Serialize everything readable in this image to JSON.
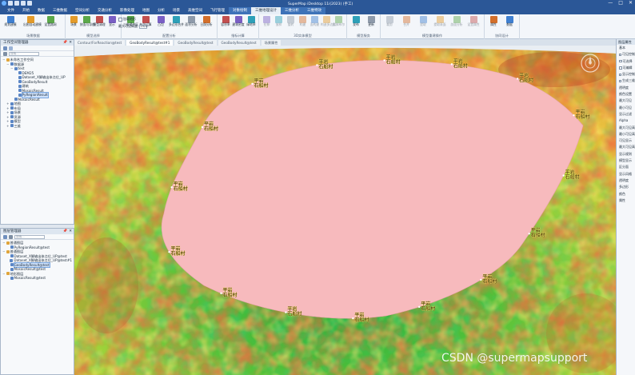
{
  "app": {
    "title": "SuperMap iDesktop 11i(2023) (手工)",
    "window_controls": [
      "—",
      "□",
      "✕"
    ]
  },
  "menu": {
    "tabs": [
      "文件",
      "开始",
      "数据",
      "三维数据",
      "空间分析",
      "交通分析",
      "影像处理",
      "地图",
      "分析",
      "场景",
      "高维空间",
      "飞行管理",
      "对象绘制",
      "三维地理设计",
      "三维分析",
      "三维特效"
    ],
    "active_index": 13
  },
  "ribbon": {
    "groups": [
      {
        "label": "场景数据",
        "buttons": [
          "规划建模",
          "出图自动建模",
          "设置路网"
        ]
      },
      {
        "label": "模型选择",
        "buttons": [
          "场景",
          "按面与导航",
          "模型清理",
          "显示"
        ]
      },
      {
        "label": "配置分析",
        "buttons": [
          "三维缓冲区",
          "布尔运算",
          "凸包",
          "多边形合并",
          "面积分析",
          "日照分析"
        ]
      },
      {
        "label": "指标计算",
        "buttons": [
          "容积率",
          "建筑密度",
          "绿地率"
        ]
      },
      {
        "label": "3D实体模型",
        "buttons": [
          "拉伸",
          "放样",
          "旋转",
          "构建",
          "面构建",
          "构造多边形",
          "实体布尔"
        ]
      },
      {
        "label": "模型服务",
        "buttons": [
          "发布",
          "更新"
        ]
      },
      {
        "label": "模型重建操作",
        "buttons": [
          "裁剪",
          "合并",
          "提取",
          "提取表面",
          "剖面分析",
          "设置属性"
        ]
      },
      {
        "label": "协同设计",
        "buttons": [
          "属性",
          "数据"
        ]
      }
    ],
    "checkbox_label": "加载地形",
    "height_label": "最大可见高度:",
    "height_value": "1924"
  },
  "workspace": {
    "title": "工作空间管理器",
    "search_placeholder": "搜索...",
    "tree": [
      {
        "label": "未命名工作空间",
        "level": 0,
        "toggle": "−"
      },
      {
        "label": "数据源",
        "level": 1,
        "toggle": "−"
      },
      {
        "label": "test",
        "level": 2,
        "toggle": "−"
      },
      {
        "label": "DEM25",
        "level": 3,
        "toggle": ""
      },
      {
        "label": "Dataset_X脚输出体点位_UP",
        "level": 3,
        "toggle": ""
      },
      {
        "label": "GeoBodyResult",
        "level": 3,
        "toggle": ""
      },
      {
        "label": "建筑",
        "level": 3,
        "toggle": ""
      },
      {
        "label": "MosaicResult",
        "level": 3,
        "toggle": ""
      },
      {
        "label": "PyRegionResult",
        "level": 3,
        "toggle": "",
        "selected": true
      },
      {
        "label": "MosaicResult",
        "level": 2,
        "toggle": ""
      },
      {
        "label": "地图",
        "level": 1,
        "toggle": "+"
      },
      {
        "label": "布局",
        "level": 1,
        "toggle": "+"
      },
      {
        "label": "场景",
        "level": 1,
        "toggle": "+"
      },
      {
        "label": "资源",
        "level": 1,
        "toggle": "+"
      },
      {
        "label": "模型",
        "level": 1,
        "toggle": "+"
      },
      {
        "label": "三维",
        "level": 1,
        "toggle": "+"
      }
    ]
  },
  "layers": {
    "title": "图层管理器",
    "search_placeholder": "搜索...",
    "tree": [
      {
        "label": "普通图层",
        "level": 0,
        "toggle": "−"
      },
      {
        "label": "PyRegionResult@test",
        "level": 1,
        "toggle": ""
      },
      {
        "label": "普通图层",
        "level": 0,
        "toggle": "−"
      },
      {
        "label": "Dataset_X脚输出体点位_UP@test",
        "level": 1,
        "toggle": ""
      },
      {
        "label": "Dataset_X脚输出体点位_UP@test#1",
        "level": 1,
        "toggle": ""
      },
      {
        "label": "GeoBodyResult@test",
        "level": 1,
        "toggle": "",
        "selected": true
      },
      {
        "label": "MosaicResult@test",
        "level": 1,
        "toggle": ""
      },
      {
        "label": "地形图层",
        "level": 0,
        "toggle": "−"
      },
      {
        "label": "MosaicResult@test",
        "level": 1,
        "toggle": ""
      }
    ]
  },
  "doc_tabs": [
    {
      "label": "Contour/ForReaction@test",
      "active": false
    },
    {
      "label": "GeoBodyResult@test#1",
      "active": true
    },
    {
      "label": "GeoBodyResult@test",
      "active": false
    },
    {
      "label": "GeoBodyResult@test",
      "active": false
    },
    {
      "label": "场景属性",
      "active": false
    }
  ],
  "scene": {
    "region_color": "#f7babd",
    "annotations": [
      "平岩",
      "石船村",
      "平岩",
      "石船村",
      "平岩",
      "石船村",
      "平岩",
      "石船村",
      "平岩",
      "石船村",
      "平岩",
      "石船村",
      "平岩",
      "石船村",
      "平岩",
      "石船村",
      "平岩",
      "石船村",
      "平岩",
      "石船村",
      "平岩",
      "石船村",
      "平岩",
      "石船村",
      "平岩",
      "石船村",
      "平岩",
      "石船村",
      "平岩",
      "石船村",
      "平岩",
      "石船村"
    ]
  },
  "properties": {
    "title": "图层属性",
    "rows": [
      "基本",
      "可见控制",
      "可选择",
      "可编辑",
      "显示控制",
      "生成三维",
      "透明度",
      "颜色设置",
      "最大可见",
      "最小可见",
      "显示过滤",
      "Alpha",
      "最大可见高度",
      "最小可见高度",
      "可见显示",
      "最大可见高度",
      "显示规则",
      "模型显示",
      "区分面",
      "显示风格",
      "透明度",
      "多边形",
      "颜色",
      "属性"
    ]
  },
  "watermark": "CSDN @supermapsupport"
}
